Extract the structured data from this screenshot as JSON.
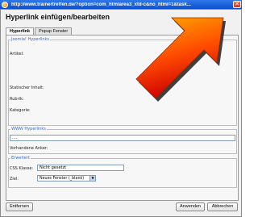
{
  "window": {
    "title": "http://www.trainertreffen.de/?option=com_htmlarea3_xtd-c&no_html=1&task...",
    "close_label": "✕"
  },
  "dialog": {
    "header": "Hyperlink einfügen/bearbeiten",
    "tabs": [
      {
        "label": "Hyperlink"
      },
      {
        "label": "Popup Fenster"
      }
    ]
  },
  "joomla": {
    "legend": "Joomla! Hyperlinks",
    "artikel_label": "Artikel:",
    "statisch_label": "Statischer Inhalt:",
    "rubrik_label": "Rubrik:",
    "kategorie_label": "Kategorie:"
  },
  "www": {
    "legend": "WWW Hyperlinks",
    "url_value": "....",
    "anker_label": "Vorhandene Anker:"
  },
  "erweitert": {
    "legend": "Erweitert",
    "css_label": "CSS Klasse:",
    "css_value": "Nicht gesetzt",
    "ziel_label": "Ziel:",
    "ziel_value": "Neues Fenster (_blank)"
  },
  "buttons": {
    "entfernen": "Entfernen",
    "anwenden": "Anwenden",
    "abbrechen": "Abbrechen"
  },
  "colors": {
    "titlebar": "#0a4fd0",
    "legend": "#3b6bc6",
    "arrow_fill_top": "#ffb000",
    "arrow_fill_bottom": "#cc0000"
  }
}
